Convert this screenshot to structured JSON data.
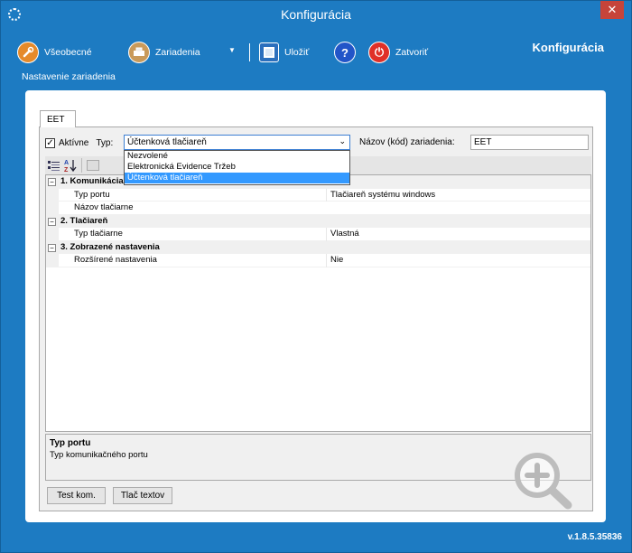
{
  "window": {
    "title": "Konfigurácia",
    "close_glyph": "✕"
  },
  "toolbar": {
    "general_label": "Všeobecné",
    "devices_label": "Zariadenia",
    "save_label": "Uložiť",
    "close_label": "Zatvoriť",
    "help_glyph": "?",
    "power_glyph": "⏻",
    "dropdown_glyph": "▼",
    "caption": "Nastavenie zariadenia",
    "brand_title": "Konfigurácia",
    "icons": [
      "wrench-icon",
      "printer-icon",
      "save-icon",
      "help-icon",
      "power-icon"
    ]
  },
  "tab": {
    "label": "EET"
  },
  "form": {
    "active_label": "Aktívne",
    "active_checked": true,
    "check_glyph": "✓",
    "type_label": "Typ:",
    "type_value": "Účtenková tlačiareň",
    "select_arrow": "⌄",
    "type_options": [
      "Nezvolené",
      "Elektronická Evidence Tržeb",
      "Účtenková tlačiareň"
    ],
    "selected_option": "Účtenková tlačiareň",
    "device_name_label": "Názov (kód) zariadenia:",
    "device_name_value": "EET"
  },
  "property_grid": {
    "toolbar_buttons": [
      "categorized-icon",
      "alphabetical-icon",
      "property-pages-icon"
    ],
    "sort_glyph": "A\nZ",
    "categories": [
      {
        "title": "1. Komunikácia",
        "collapse_glyph": "−",
        "props": [
          {
            "name": "Typ portu",
            "value": "Tlačiareň systému windows"
          },
          {
            "name": "Názov tlačiarne",
            "value": ""
          }
        ]
      },
      {
        "title": "2. Tlačiareň",
        "collapse_glyph": "−",
        "props": [
          {
            "name": "Typ tlačiarne",
            "value": "Vlastná"
          }
        ]
      },
      {
        "title": "3. Zobrazené nastavenia",
        "collapse_glyph": "−",
        "props": [
          {
            "name": "Rozšírené nastavenia",
            "value": "Nie"
          }
        ]
      }
    ],
    "help": {
      "title": "Typ portu",
      "description": "Typ komunikačného portu"
    }
  },
  "buttons": {
    "test_label": "Test kom.",
    "print_label": "Tlač textov"
  },
  "footer": {
    "version": "v.1.8.5.35836"
  },
  "colors": {
    "window_bg": "#1d7bc2",
    "selection": "#3399ff",
    "close_red": "#c6443a"
  }
}
